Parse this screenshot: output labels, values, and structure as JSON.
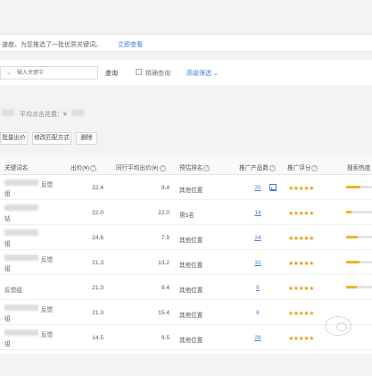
{
  "notice": {
    "text": "速度。为您推选了一批优质关键词。",
    "link": "立即查看"
  },
  "search": {
    "placeholder": "输入关键字",
    "button": "查询",
    "exact_label": "精确查询",
    "advanced_filter": "高级筛选 ⌄"
  },
  "click_cost": {
    "label": "平均点击花费：¥"
  },
  "actions": {
    "modify_bid": "批量出价",
    "modify_match": "修改匹配方式",
    "delete": "删除"
  },
  "table": {
    "headers": {
      "keyword": "关键词名",
      "bid": "出价(¥)",
      "peer_avg": "同行平均出价(¥)",
      "rank": "预估排名",
      "products": "推广产品数",
      "score": "推广评分",
      "heat": "搜索热度"
    },
    "help_icon": "?",
    "rows": [
      {
        "kw_line1": "反馈",
        "kw_line2": "组",
        "bid": "22.4",
        "peer_avg": "9.4",
        "rank": "其他位置",
        "products": "20",
        "stars": "★★★★★",
        "heat": 0.55
      },
      {
        "kw_line1": "",
        "kw_line2": "钻",
        "bid": "22.0",
        "peer_avg": "22.0",
        "rank": "第5名",
        "products": "14",
        "stars": "★★★★★",
        "heat": 0.2
      },
      {
        "kw_line1": "",
        "kw_line2": "组",
        "bid": "24.6",
        "peer_avg": "7.9",
        "rank": "其他位置",
        "products": "24",
        "stars": "★★★★★",
        "heat": 0.45
      },
      {
        "kw_line1": "反馈",
        "kw_line2": "组",
        "bid": "21.3",
        "peer_avg": "13.2",
        "rank": "其他位置",
        "products": "31",
        "stars": "★★★★★",
        "heat": 0.5
      },
      {
        "kw_line1": "",
        "kw_line2": "反馈组",
        "bid": "21.3",
        "peer_avg": "9.4",
        "rank": "其他位置",
        "products": "5",
        "stars": "★★★★★",
        "heat": 0.4
      },
      {
        "kw_line1": "反馈",
        "kw_line2": "组",
        "bid": "21.3",
        "peer_avg": "15.4",
        "rank": "其他位置",
        "products": "8",
        "stars": "★★★★★",
        "heat": 0.3
      },
      {
        "kw_line1": "反馈",
        "kw_line2": "组",
        "bid": "14.5",
        "peer_avg": "9.5",
        "rank": "其他位置",
        "products": "28",
        "stars": "★★★★★",
        "heat": 0.35
      }
    ]
  },
  "colors": {
    "link": "#3d7bd6",
    "stars": "#e2a11c",
    "heat_fill": "#f0b429"
  }
}
